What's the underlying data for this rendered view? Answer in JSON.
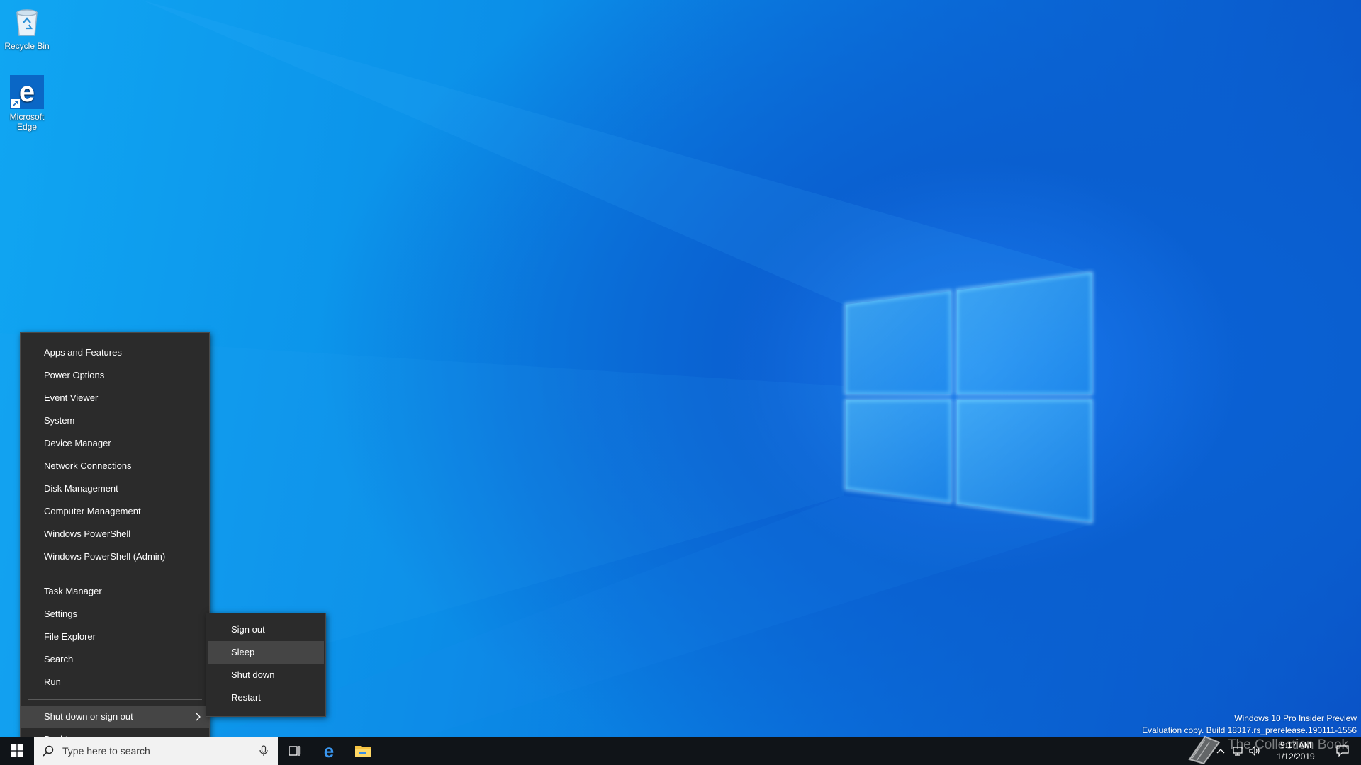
{
  "desktop": {
    "icons": [
      {
        "label": "Recycle Bin",
        "icon": "recycle-bin-icon"
      },
      {
        "label": "Microsoft Edge",
        "icon": "edge-icon"
      }
    ]
  },
  "winx_menu": {
    "group1": [
      "Apps and Features",
      "Power Options",
      "Event Viewer",
      "System",
      "Device Manager",
      "Network Connections",
      "Disk Management",
      "Computer Management",
      "Windows PowerShell",
      "Windows PowerShell (Admin)"
    ],
    "group2": [
      "Task Manager",
      "Settings",
      "File Explorer",
      "Search",
      "Run"
    ],
    "group3": [
      "Shut down or sign out",
      "Desktop"
    ],
    "active_item": "Shut down or sign out"
  },
  "shutdown_submenu": {
    "items": [
      "Sign out",
      "Sleep",
      "Shut down",
      "Restart"
    ],
    "highlighted": "Sleep"
  },
  "watermark": {
    "line1": "Windows 10 Pro Insider Preview",
    "line2": "Evaluation copy. Build 18317.rs_prerelease.190111-1556",
    "site": "The Collection Book"
  },
  "taskbar": {
    "search_placeholder": "Type here to search",
    "clock": {
      "time": "9:17 AM",
      "date": "1/12/2019"
    }
  },
  "colors": {
    "menu_bg": "#2b2b2b",
    "menu_active": "#454545",
    "taskbar_bg": "#101418",
    "accent": "#76b9ed"
  }
}
